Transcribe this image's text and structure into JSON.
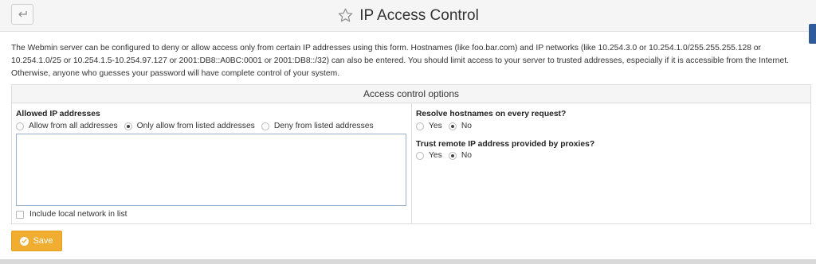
{
  "header": {
    "back_icon": "back-arrow-icon",
    "star_icon": "star-icon",
    "title": "IP Access Control"
  },
  "description": "The Webmin server can be configured to deny or allow access only from certain IP addresses using this form. Hostnames (like foo.bar.com) and IP networks (like 10.254.3.0 or 10.254.1.0/255.255.255.128 or 10.254.1.0/25 or 10.254.1.5-10.254.97.127 or 2001:DB8::A0BC:0001 or 2001:DB8::/32) can also be entered. You should limit access to your server to trusted addresses, especially if it is accessible from the Internet. Otherwise, anyone who guesses your password will have complete control of your system.",
  "panel": {
    "title": "Access control options",
    "allowed": {
      "label": "Allowed IP addresses",
      "options": [
        {
          "label": "Allow from all addresses",
          "selected": false
        },
        {
          "label": "Only allow from listed addresses",
          "selected": true
        },
        {
          "label": "Deny from listed addresses",
          "selected": false
        }
      ],
      "textarea_value": "",
      "include_local_label": "Include local network in list",
      "include_local_checked": false
    },
    "resolve": {
      "label": "Resolve hostnames on every request?",
      "yes_label": "Yes",
      "no_label": "No",
      "selected": "No"
    },
    "trust": {
      "label": "Trust remote IP address provided by proxies?",
      "yes_label": "Yes",
      "no_label": "No",
      "selected": "No"
    }
  },
  "save_button": {
    "label": "Save",
    "icon": "check-circle-icon"
  },
  "colors": {
    "save_bg": "#f0ad2f",
    "side_tab": "#2f5b9a"
  }
}
